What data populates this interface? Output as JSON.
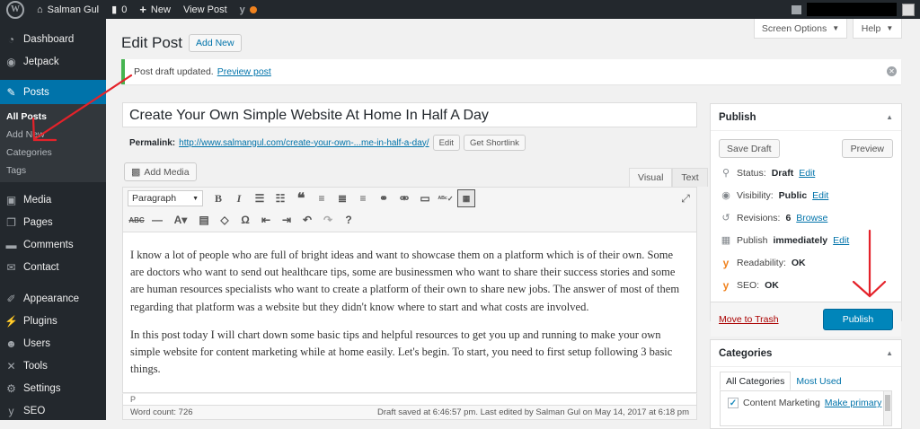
{
  "admin_bar": {
    "site_name": "Salman Gul",
    "comments_count": "0",
    "new_label": "New",
    "view_post_label": "View Post"
  },
  "sidebar": {
    "items": [
      {
        "label": "Dashboard",
        "icon": "dashboard-icon"
      },
      {
        "label": "Jetpack",
        "icon": "jetpack-icon"
      },
      {
        "label": "Posts",
        "icon": "pin-icon"
      },
      {
        "label": "Media",
        "icon": "media-icon"
      },
      {
        "label": "Pages",
        "icon": "pages-icon"
      },
      {
        "label": "Comments",
        "icon": "comments-icon"
      },
      {
        "label": "Contact",
        "icon": "mail-icon"
      },
      {
        "label": "Appearance",
        "icon": "brush-icon"
      },
      {
        "label": "Plugins",
        "icon": "plugin-icon"
      },
      {
        "label": "Users",
        "icon": "users-icon"
      },
      {
        "label": "Tools",
        "icon": "wrench-icon"
      },
      {
        "label": "Settings",
        "icon": "settings-icon"
      },
      {
        "label": "SEO",
        "icon": "seo-icon"
      }
    ],
    "posts_submenu": [
      "All Posts",
      "Add New",
      "Categories",
      "Tags"
    ]
  },
  "header": {
    "title": "Edit Post",
    "add_new": "Add New",
    "screen_options": "Screen Options",
    "help": "Help"
  },
  "notice": {
    "text": "Post draft updated.",
    "link": "Preview post"
  },
  "editor": {
    "post_title": "Create Your Own Simple Website At Home In Half A Day",
    "permalink_label": "Permalink:",
    "permalink_url": "http://www.salmangul.com/create-your-own-...me-in-half-a-day/",
    "edit_btn": "Edit",
    "shortlink_btn": "Get Shortlink",
    "add_media": "Add Media",
    "tab_visual": "Visual",
    "tab_text": "Text",
    "format_select": "Paragraph",
    "paragraphs": [
      "I know a lot of people who are full of bright ideas and want to showcase them on a platform which is of their own. Some are doctors who want to send out healthcare tips, some are businessmen who want to share their success stories and some are human resources specialists who want to create a platform of their own to share new jobs. The answer of most of them regarding that platform was a website but they didn't know where to start and what costs are involved.",
      "In this post today I will chart down some basic tips and helpful resources to get you up and running to make your own simple website for content marketing while at home easily. Let's begin. To start, you need to first setup following 3 basic things."
    ],
    "path": "P",
    "word_count": "Word count: 726",
    "saved_status": "Draft saved at 6:46:57 pm. Last edited by Salman Gul on May 14, 2017 at 6:18 pm"
  },
  "publish_box": {
    "title": "Publish",
    "save_draft": "Save Draft",
    "preview": "Preview",
    "status_label": "Status:",
    "status_value": "Draft",
    "visibility_label": "Visibility:",
    "visibility_value": "Public",
    "revisions_label": "Revisions:",
    "revisions_value": "6",
    "browse": "Browse",
    "publish_label": "Publish",
    "publish_value": "immediately",
    "readability_label": "Readability:",
    "readability_value": "OK",
    "seo_label": "SEO:",
    "seo_value": "OK",
    "edit": "Edit",
    "move_to_trash": "Move to Trash",
    "publish_button": "Publish"
  },
  "categories_box": {
    "title": "Categories",
    "tab_all": "All Categories",
    "tab_most_used": "Most Used",
    "item_label": "Content Marketing",
    "make_primary": "Make primary"
  },
  "colors": {
    "admin_bar": "#23282d",
    "accent": "#0073aa",
    "publish_button": "#0085ba",
    "annotation_arrow": "#e4222a"
  }
}
